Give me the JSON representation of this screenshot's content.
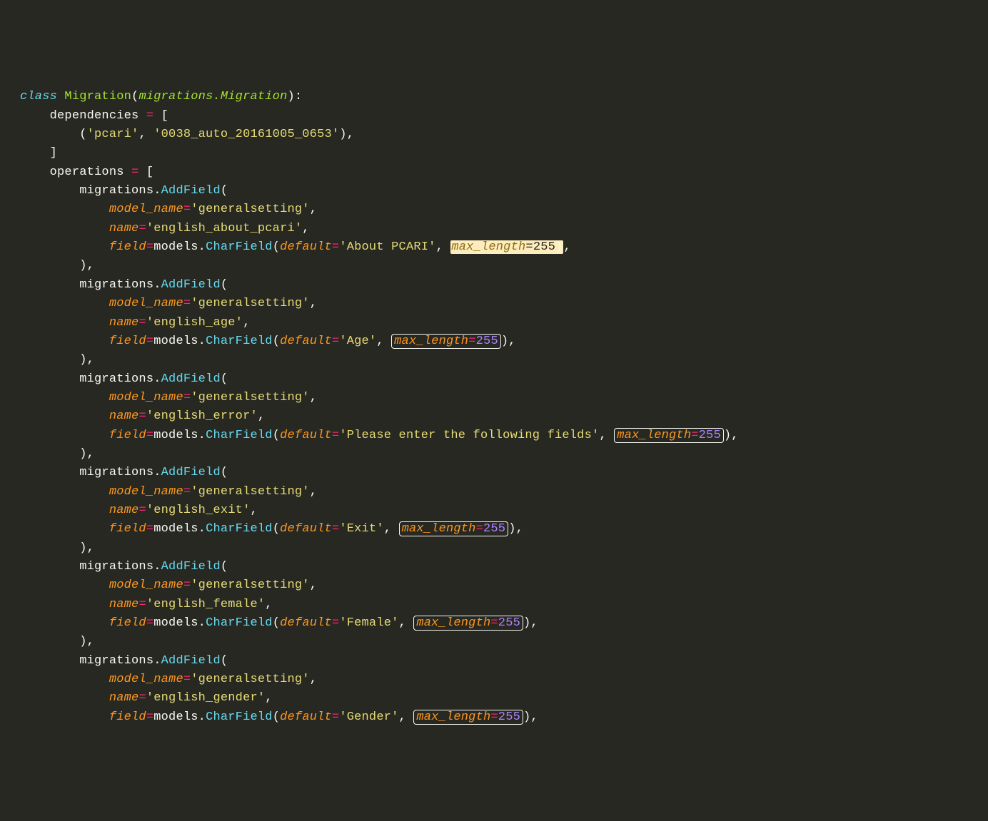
{
  "tokens": {
    "class_kw": "class",
    "class_name": "Migration",
    "base_arg": "migrations.Migration",
    "dependencies_label": "dependencies",
    "operations_label": "operations",
    "dep_app": "'pcari'",
    "dep_name": "'0038_auto_20161005_0653'",
    "migrations": "migrations",
    "models": "models",
    "addfield": "AddField",
    "charfield": "CharField",
    "kw_model_name": "model_name",
    "kw_name": "name",
    "kw_field": "field",
    "kw_default": "default",
    "kw_max_length": "max_length",
    "max_len_val": "255",
    "model_generalsetting": "'generalsetting'"
  },
  "fields": [
    {
      "name": "'english_about_pcari'",
      "default": "'About PCARI'",
      "hl_style": "sel"
    },
    {
      "name": "'english_age'",
      "default": "'Age'",
      "hl_style": "box"
    },
    {
      "name": "'english_error'",
      "default": "'Please enter the following fields'",
      "hl_style": "box"
    },
    {
      "name": "'english_exit'",
      "default": "'Exit'",
      "hl_style": "box"
    },
    {
      "name": "'english_female'",
      "default": "'Female'",
      "hl_style": "box"
    },
    {
      "name": "'english_gender'",
      "default": "'Gender'",
      "hl_style": "box"
    }
  ]
}
